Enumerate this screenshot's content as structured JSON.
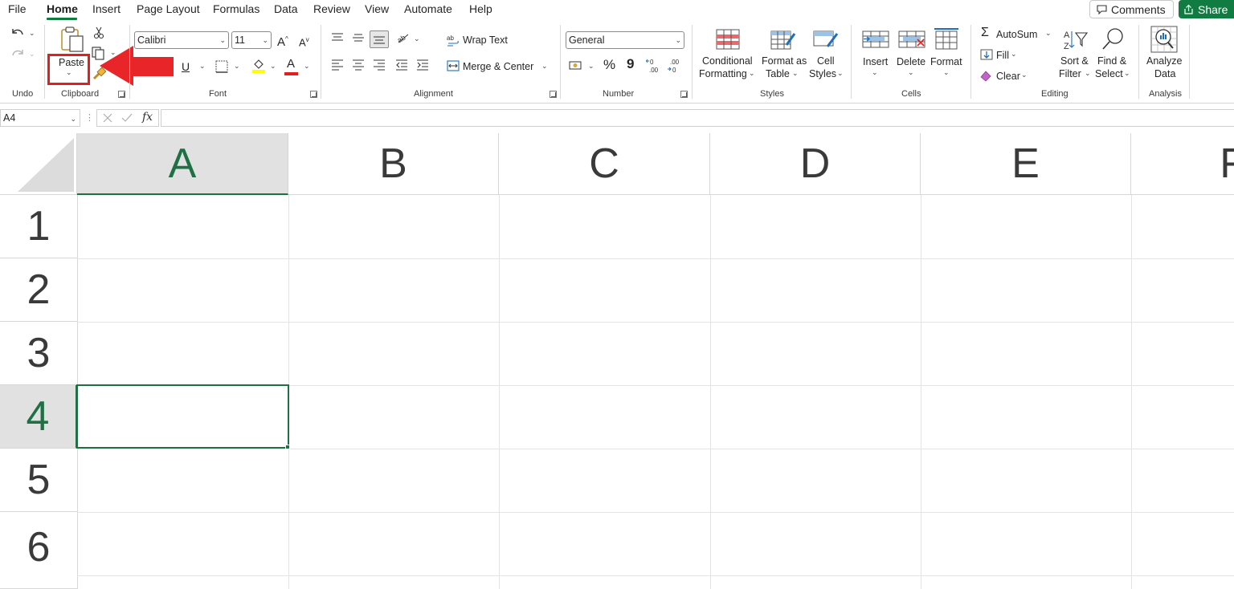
{
  "menu": {
    "items": [
      "File",
      "Home",
      "Insert",
      "Page Layout",
      "Formulas",
      "Data",
      "Review",
      "View",
      "Automate",
      "Help"
    ],
    "active": "Home",
    "comments_label": "Comments",
    "share_label": "Share"
  },
  "ribbon": {
    "undo": {
      "group_label": "Undo"
    },
    "clipboard": {
      "paste_label": "Paste",
      "group_label": "Clipboard"
    },
    "font": {
      "font_name": "Calibri",
      "font_size": "11",
      "underline_label": "U",
      "font_color_label": "A",
      "group_label": "Font"
    },
    "alignment": {
      "wrap_text_label": "Wrap Text",
      "merge_center_label": "Merge & Center",
      "group_label": "Alignment"
    },
    "number": {
      "format": "General",
      "percent_label": "%",
      "comma_label": "9",
      "group_label": "Number"
    },
    "styles": {
      "conditional_line1": "Conditional",
      "conditional_line2": "Formatting",
      "format_table_line1": "Format as",
      "format_table_line2": "Table",
      "cell_styles_line1": "Cell",
      "cell_styles_line2": "Styles",
      "group_label": "Styles"
    },
    "cells": {
      "insert_label": "Insert",
      "delete_label": "Delete",
      "format_label": "Format",
      "group_label": "Cells"
    },
    "editing": {
      "autosum_label": "AutoSum",
      "fill_label": "Fill",
      "clear_label": "Clear",
      "sort_line1": "Sort &",
      "sort_line2": "Filter",
      "find_line1": "Find &",
      "find_line2": "Select",
      "group_label": "Editing"
    },
    "analysis": {
      "analyze_line1": "Analyze",
      "analyze_line2": "Data",
      "group_label": "Analysis"
    }
  },
  "formula_bar": {
    "name_box": "A4",
    "fx_label": "fx",
    "formula": ""
  },
  "grid": {
    "columns": [
      "A",
      "B",
      "C",
      "D",
      "E",
      "F"
    ],
    "rows": [
      "1",
      "2",
      "3",
      "4",
      "5",
      "6"
    ],
    "selected_cell": "A4"
  },
  "colors": {
    "accent": "#107c41",
    "highlight": "#e8262a",
    "selected_header_text": "#1f7145"
  }
}
